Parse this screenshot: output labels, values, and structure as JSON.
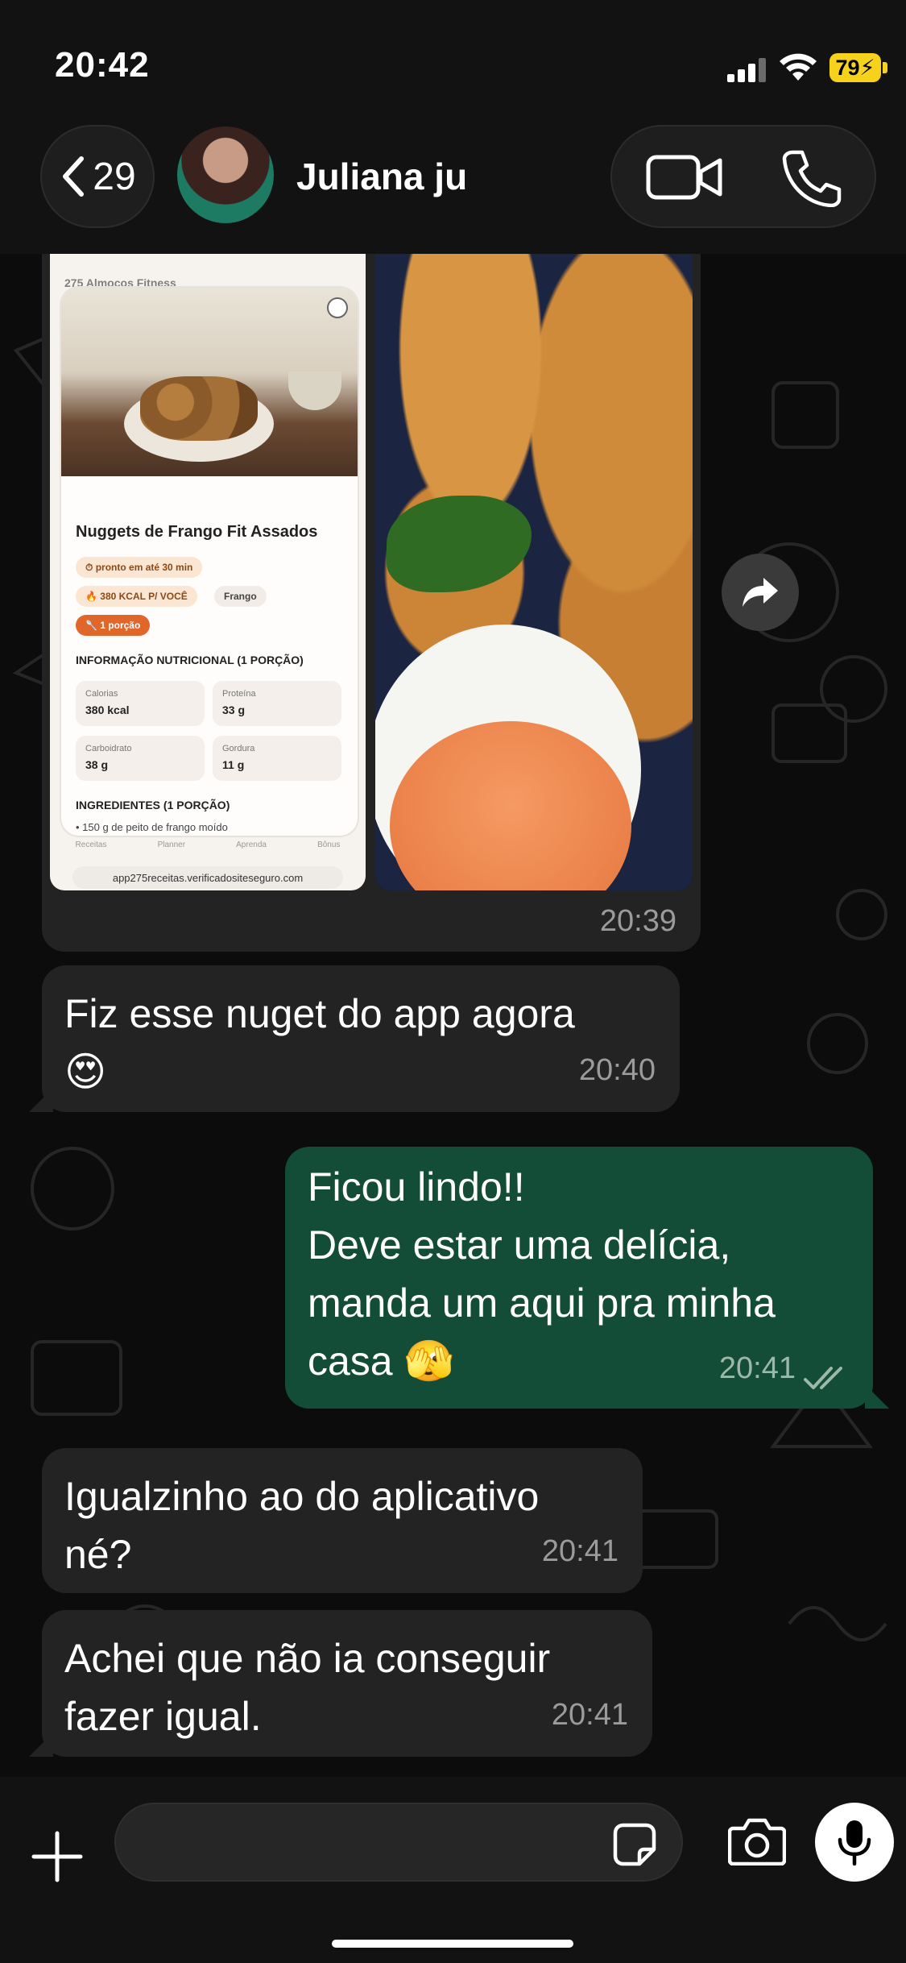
{
  "status_bar": {
    "time": "20:42",
    "battery": "79"
  },
  "header": {
    "back_count": "29",
    "contact_name": "Juliana ju"
  },
  "media_message": {
    "time": "20:39",
    "screenshot": {
      "app_header": "275 Almoços Fitness",
      "recipe_title": "Nuggets de Frango Fit Assados",
      "chip_time": "⏱ pronto em até 30 min",
      "chip_kcal": "🔥 380 KCAL P/ VOCÊ",
      "chip_category": "Frango",
      "chip_portion": "🥄 1 porção",
      "nutrition_heading": "INFORMAÇÃO NUTRICIONAL (1 PORÇÃO)",
      "nutrition": [
        {
          "label": "Calorias",
          "value": "380 kcal"
        },
        {
          "label": "Proteína",
          "value": "33 g"
        },
        {
          "label": "Carboidrato",
          "value": "38 g"
        },
        {
          "label": "Gordura",
          "value": "11 g"
        }
      ],
      "ingredients_heading": "INGREDIENTES (1 PORÇÃO)",
      "ingredient_1": "• 150 g de peito de frango moído",
      "nav": [
        "Receitas",
        "Planner",
        "Aprenda",
        "Bônus"
      ],
      "url": "app275receitas.verificadositeseguro.com"
    }
  },
  "messages": [
    {
      "direction": "in",
      "line1": "Fiz esse nuget do app agora",
      "line2": "😍",
      "time": "20:40"
    },
    {
      "direction": "out",
      "line1": "Ficou lindo!!",
      "line2": "Deve estar uma delícia,",
      "line3": "manda um aqui pra minha",
      "line4": "casa 🫣",
      "time": "20:41",
      "status": "read"
    },
    {
      "direction": "in",
      "line1": "Igualzinho ao do aplicativo",
      "line2": "né?",
      "time": "20:41"
    },
    {
      "direction": "in",
      "line1": "Achei que não ia conseguir",
      "line2": "fazer igual.",
      "time": "20:41"
    }
  ],
  "colors": {
    "incoming_bubble": "#232323",
    "outgoing_bubble": "#134d37",
    "battery": "#f7d21c"
  },
  "icons": [
    "back-chevron-icon",
    "video-call-icon",
    "phone-call-icon",
    "forward-icon",
    "plus-icon",
    "sticker-icon",
    "camera-icon",
    "microphone-icon",
    "double-check-icon"
  ]
}
